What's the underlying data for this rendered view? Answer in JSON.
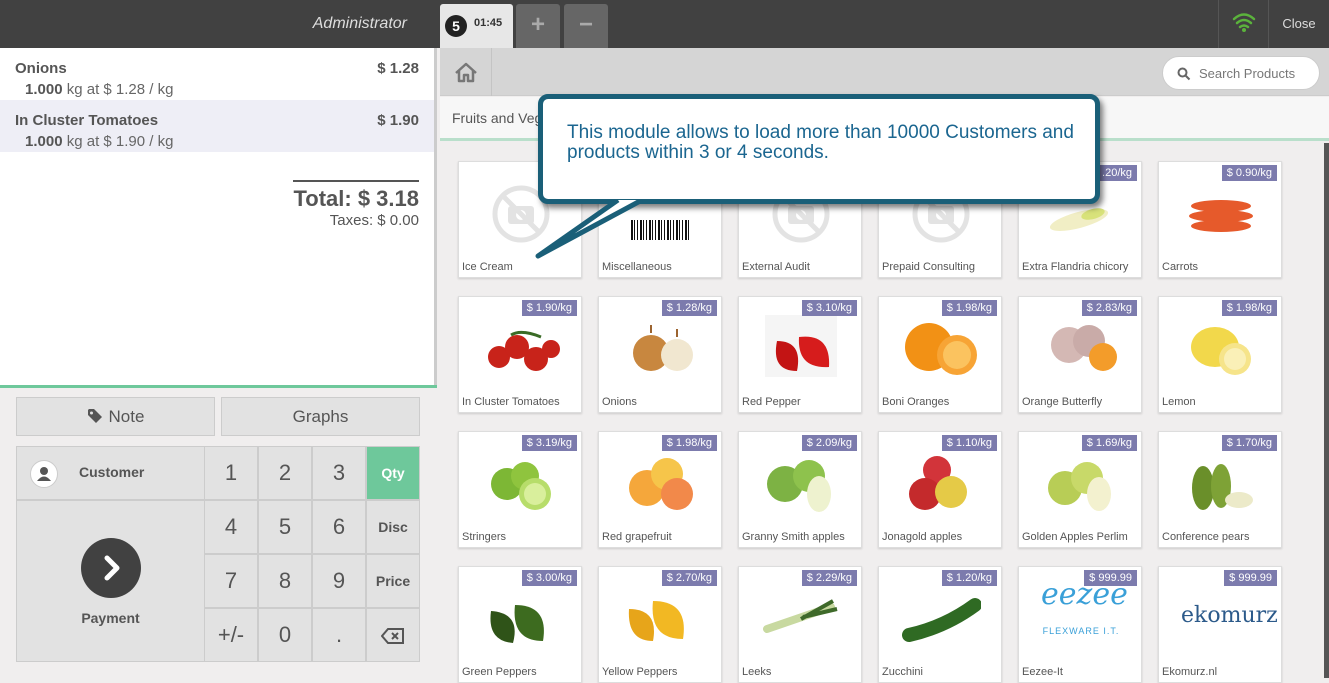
{
  "header": {
    "user": "Administrator",
    "order_number": "5",
    "order_time": "01:45",
    "add_label": "+",
    "remove_label": "−",
    "close_label": "Close"
  },
  "order": {
    "lines": [
      {
        "name": "Onions",
        "price": "$ 1.28",
        "qty": "1.000",
        "info": " kg at $ 1.28 / kg"
      },
      {
        "name": "In Cluster Tomatoes",
        "price": "$ 1.90",
        "qty": "1.000",
        "info": " kg at $ 1.90 / kg"
      }
    ],
    "total": "Total: $ 3.18",
    "taxes": "Taxes: $ 0.00"
  },
  "controls": {
    "note": "Note",
    "graphs": "Graphs",
    "customer": "Customer",
    "payment": "Payment",
    "keys": [
      "1",
      "2",
      "3",
      "4",
      "5",
      "6",
      "7",
      "8",
      "9",
      "+/-",
      "0",
      "."
    ],
    "modes": [
      "Qty",
      "Disc",
      "Price"
    ]
  },
  "search": {
    "placeholder": "Search Products"
  },
  "breadcrumb": "Fruits and Veg",
  "callout": "This module allows to load more than 10000 Customers and products within 3 or 4 seconds.",
  "products": [
    {
      "name": "Ice Cream",
      "price": "$",
      "icon": "no-image-icon"
    },
    {
      "name": "Miscellaneous",
      "price": "",
      "icon": "barcode-icon"
    },
    {
      "name": "External Audit",
      "price": "",
      "icon": "no-image-icon"
    },
    {
      "name": "Prepaid Consulting",
      "price": "",
      "icon": "no-image-icon"
    },
    {
      "name": "Extra Flandria chicory",
      "price": ".20/kg",
      "icon": "chicory-image"
    },
    {
      "name": "Carrots",
      "price": "$ 0.90/kg",
      "icon": "carrots-image"
    },
    {
      "name": "In Cluster Tomatoes",
      "price": "$ 1.90/kg",
      "icon": "tomatoes-image"
    },
    {
      "name": "Onions",
      "price": "$ 1.28/kg",
      "icon": "onions-image"
    },
    {
      "name": "Red Pepper",
      "price": "$ 3.10/kg",
      "icon": "red-pepper-image"
    },
    {
      "name": "Boni Oranges",
      "price": "$ 1.98/kg",
      "icon": "oranges-image"
    },
    {
      "name": "Orange Butterfly",
      "price": "$ 2.83/kg",
      "icon": "orange-butterfly-image"
    },
    {
      "name": "Lemon",
      "price": "$ 1.98/kg",
      "icon": "lemon-image"
    },
    {
      "name": "Stringers",
      "price": "$ 3.19/kg",
      "icon": "limes-image"
    },
    {
      "name": "Red grapefruit",
      "price": "$ 1.98/kg",
      "icon": "grapefruit-image"
    },
    {
      "name": "Granny Smith apples",
      "price": "$ 2.09/kg",
      "icon": "green-apples-image"
    },
    {
      "name": "Jonagold apples",
      "price": "$ 1.10/kg",
      "icon": "red-apples-image"
    },
    {
      "name": "Golden Apples Perlim",
      "price": "$ 1.69/kg",
      "icon": "golden-apples-image"
    },
    {
      "name": "Conference pears",
      "price": "$ 1.70/kg",
      "icon": "pears-image"
    },
    {
      "name": "Green Peppers",
      "price": "$ 3.00/kg",
      "icon": "green-peppers-image"
    },
    {
      "name": "Yellow Peppers",
      "price": "$ 2.70/kg",
      "icon": "yellow-peppers-image"
    },
    {
      "name": "Leeks",
      "price": "$ 2.29/kg",
      "icon": "leeks-image"
    },
    {
      "name": "Zucchini",
      "price": "$ 1.20/kg",
      "icon": "zucchini-image"
    },
    {
      "name": "Eezee-It",
      "price": "$ 999.99",
      "icon": "eezee-logo",
      "logo_text": "eezee",
      "logo_sub": "FLEXWARE I.T."
    },
    {
      "name": "Ekomurz.nl",
      "price": "$ 999.99",
      "icon": "ekomurz-logo",
      "logo_text": "ekomurz"
    }
  ],
  "colors": {
    "topbar": "#414141",
    "accent": "#6ec89b",
    "price_tag": "#7c7bad",
    "callout_border": "#1a5f78",
    "callout_text": "#1b6690",
    "wifi": "#5bb33c"
  }
}
